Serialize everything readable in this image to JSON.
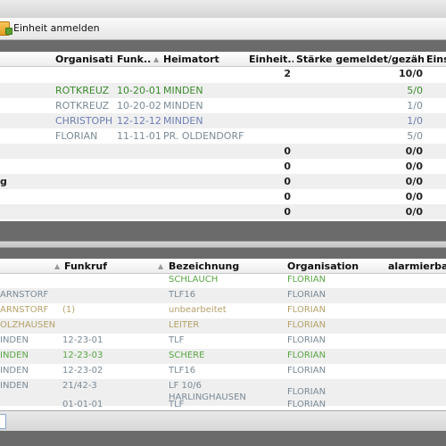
{
  "toolbar": {
    "button_label": "Einheit anmelden",
    "button_icon": "register-unit-icon"
  },
  "top_table": {
    "headers": [
      "Organisati...",
      "Funk...",
      "Heimatort",
      "Einheit...",
      "Stärke gemeldet/gezählt",
      "Eins"
    ],
    "sort_icon": "sort-asc-icon",
    "rows": [
      {
        "first": "",
        "org": "",
        "funk": "",
        "heimat": "",
        "einheit": "2",
        "staerke": "10/0"
      },
      {
        "first": "",
        "org": "ROTKREUZ",
        "funk": "10-20-01",
        "heimat": "MINDEN",
        "einheit": "",
        "staerke": "5/0"
      },
      {
        "first": "",
        "org": "ROTKREUZ",
        "funk": "10-20-02",
        "heimat": "MINDEN",
        "einheit": "",
        "staerke": "1/0"
      },
      {
        "first": "",
        "org": "CHRISTOPH",
        "funk": "12-12-12",
        "heimat": "MINDEN",
        "einheit": "",
        "staerke": "1/0"
      },
      {
        "first": "",
        "org": "FLORIAN",
        "funk": "11-11-01",
        "heimat": "PR. OLDENDORF",
        "einheit": "",
        "staerke": "5/0"
      },
      {
        "first": "",
        "org": "",
        "funk": "",
        "heimat": "",
        "einheit": "0",
        "staerke": "0/0"
      },
      {
        "first": "",
        "org": "",
        "funk": "",
        "heimat": "",
        "einheit": "0",
        "staerke": "0/0"
      },
      {
        "first": "g",
        "org": "",
        "funk": "",
        "heimat": "",
        "einheit": "0",
        "staerke": "0/0"
      },
      {
        "first": "",
        "org": "",
        "funk": "",
        "heimat": "",
        "einheit": "0",
        "staerke": "0/0"
      },
      {
        "first": "",
        "org": "",
        "funk": "",
        "heimat": "",
        "einheit": "0",
        "staerke": "0/0"
      }
    ]
  },
  "bottom_table": {
    "headers": [
      "Funkruf",
      "Bezeichnung",
      "Organisation",
      "alarmierbar"
    ],
    "sort_icon": "sort-asc-icon",
    "rows": [
      {
        "ort": "",
        "funkruf": "",
        "bez": "SCHLAUCH",
        "org": "FLORIAN"
      },
      {
        "ort": "ARNSTORF",
        "funkruf": "",
        "bez": "TLF16",
        "org": "FLORIAN"
      },
      {
        "ort": "ARNSTORF",
        "funkruf": "(1)",
        "bez": "unbearbeitet",
        "org": "FLORIAN"
      },
      {
        "ort": "OLZHAUSEN",
        "funkruf": "",
        "bez": "LEITER",
        "org": "FLORIAN"
      },
      {
        "ort": "INDEN",
        "funkruf": "12-23-01",
        "bez": "TLF",
        "org": "FLORIAN"
      },
      {
        "ort": "INDEN",
        "funkruf": "12-23-03",
        "bez": "SCHERE",
        "org": "FLORIAN"
      },
      {
        "ort": "INDEN",
        "funkruf": "12-23-02",
        "bez": "TLF16",
        "org": "FLORIAN"
      },
      {
        "ort": "INDEN",
        "funkruf": "21/42-3",
        "bez": "LF 10/6",
        "bez2": "HARLINGHAUSEN",
        "org": "FLORIAN"
      },
      {
        "ort": "",
        "funkruf": "01-01-01",
        "bez": "TLF",
        "org": "FLORIAN"
      }
    ]
  }
}
